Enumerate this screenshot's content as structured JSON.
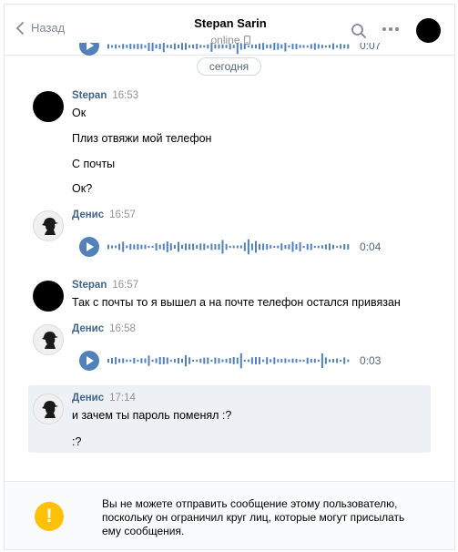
{
  "header": {
    "back_label": "Назад",
    "title": "Stepan Sarin",
    "status": "online"
  },
  "top_audio": {
    "duration": "0:07"
  },
  "date_separator": "сегодня",
  "messages": [
    {
      "author": "Stepan",
      "time": "16:53",
      "lines": [
        "Ок",
        "Плиз отвяжи мой телефон",
        "С почты",
        "Ок?"
      ]
    },
    {
      "author": "Денис",
      "time": "16:57",
      "audio_duration": "0:04"
    },
    {
      "author": "Stepan",
      "time": "16:57",
      "lines": [
        "Так с почты то я вышел а на почте телефон остался привязан"
      ]
    },
    {
      "author": "Денис",
      "time": "16:58",
      "audio_duration": "0:03"
    },
    {
      "author": "Денис",
      "time": "17:14",
      "lines": [
        "и зачем ты пароль поменял :?",
        ":?"
      ]
    }
  ],
  "footer": {
    "icon": "exclamation-warning-icon",
    "text": "Вы не можете отправить сообщение этому пользователю, поскольку он ограничил круг лиц, которые могут присылать ему сообщения."
  },
  "colors": {
    "accent": "#5181b8",
    "name": "#42648b",
    "warning": "#ffc107",
    "highlight": "#edf0f5"
  }
}
